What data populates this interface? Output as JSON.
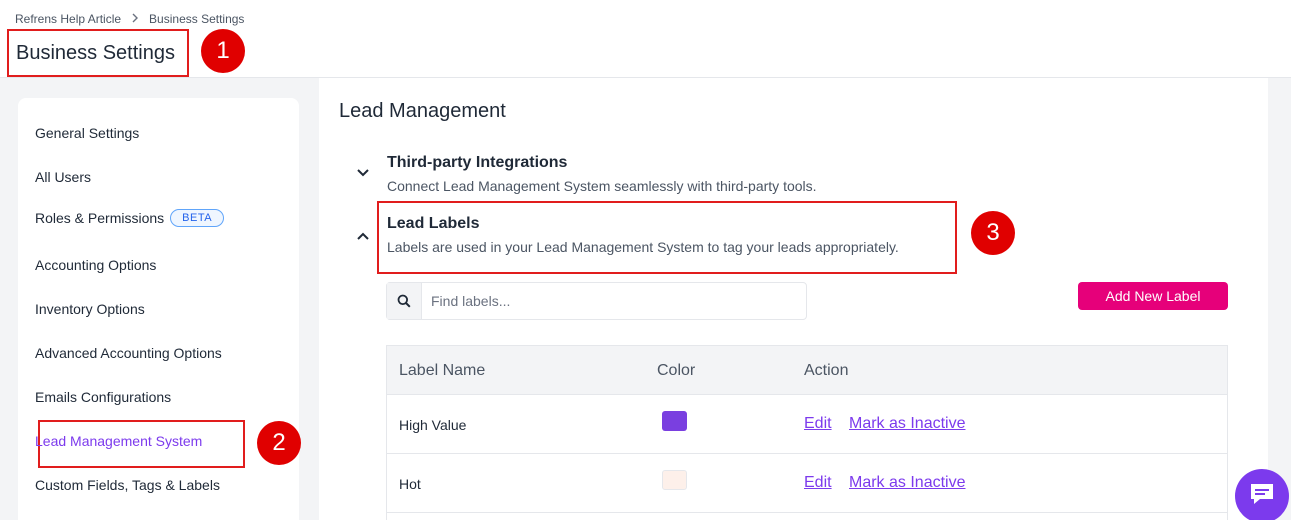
{
  "breadcrumb": {
    "root": "Refrens Help Article",
    "current": "Business Settings"
  },
  "page_title": "Business Settings",
  "annotations": [
    "1",
    "2",
    "3"
  ],
  "sidebar": {
    "items": [
      {
        "label": "General Settings"
      },
      {
        "label": "All Users"
      },
      {
        "label": "Roles & Permissions",
        "badge": "BETA"
      },
      {
        "label": "Accounting Options"
      },
      {
        "label": "Inventory Options"
      },
      {
        "label": "Advanced Accounting Options"
      },
      {
        "label": "Emails Configurations"
      },
      {
        "label": "Lead Management System",
        "active": true
      },
      {
        "label": "Custom Fields, Tags & Labels"
      }
    ]
  },
  "main": {
    "title": "Lead Management",
    "sections": [
      {
        "title": "Third-party Integrations",
        "description": "Connect Lead Management System seamlessly with third-party tools.",
        "expanded": false
      },
      {
        "title": "Lead Labels",
        "description": "Labels are used in your Lead Management System to tag your leads appropriately.",
        "expanded": true
      }
    ],
    "search": {
      "placeholder": "Find labels...",
      "value": ""
    },
    "add_button": "Add New Label",
    "table": {
      "headers": [
        "Label Name",
        "Color",
        "Action"
      ],
      "rows": [
        {
          "name": "High Value",
          "color": "#7a3fe0",
          "edit": "Edit",
          "inactive": "Mark as Inactive"
        },
        {
          "name": "Hot",
          "color": "#fdf0ea",
          "edit": "Edit",
          "inactive": "Mark as Inactive"
        }
      ]
    }
  },
  "colors": {
    "accent": "#7c3aed",
    "primary_button": "#e6007a",
    "annotation": "#e00000"
  },
  "icons": [
    "chevron-right-icon",
    "chevron-down-icon",
    "chevron-up-icon",
    "search-icon",
    "chat-icon"
  ]
}
